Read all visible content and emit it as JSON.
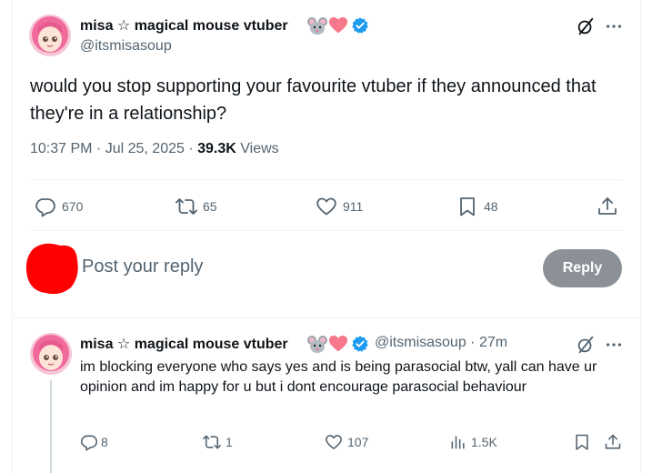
{
  "main_tweet": {
    "display_name": "misa ☆ magical mouse vtuber",
    "handle": "@itsmisasoup",
    "text": "would you stop supporting your favourite vtuber if they announced that they're in a relationship?",
    "time": "10:37 PM",
    "date": "Jul 25, 2025",
    "views_count": "39.3K",
    "views_label": "Views",
    "stats": {
      "replies": "670",
      "reposts": "65",
      "likes": "911",
      "bookmarks": "48"
    }
  },
  "reply_composer": {
    "placeholder": "Post your reply",
    "button_label": "Reply"
  },
  "reply_tweet": {
    "display_name": "misa ☆ magical mouse vtuber",
    "handle": "@itsmisasoup",
    "age": "27m",
    "text": "im blocking everyone who says yes and is being parasocial btw, yall can have ur opinion and im happy for u but i dont encourage parasocial behaviour",
    "stats": {
      "replies": "8",
      "reposts": "1",
      "likes": "107",
      "views": "1.5K"
    }
  },
  "colors": {
    "secondary_text": "#536471",
    "verified_blue": "#1d9bf0",
    "reply_button_bg": "#8b9196",
    "redaction": "#ff0000",
    "avatar_hair": "#f06b9c"
  },
  "icons": [
    "mouse-emoji-icon",
    "heart-emoji-icon",
    "verified-badge-icon",
    "grok-icon",
    "more-icon",
    "reply-icon",
    "repost-icon",
    "like-icon",
    "bookmark-icon",
    "share-icon",
    "views-icon"
  ]
}
